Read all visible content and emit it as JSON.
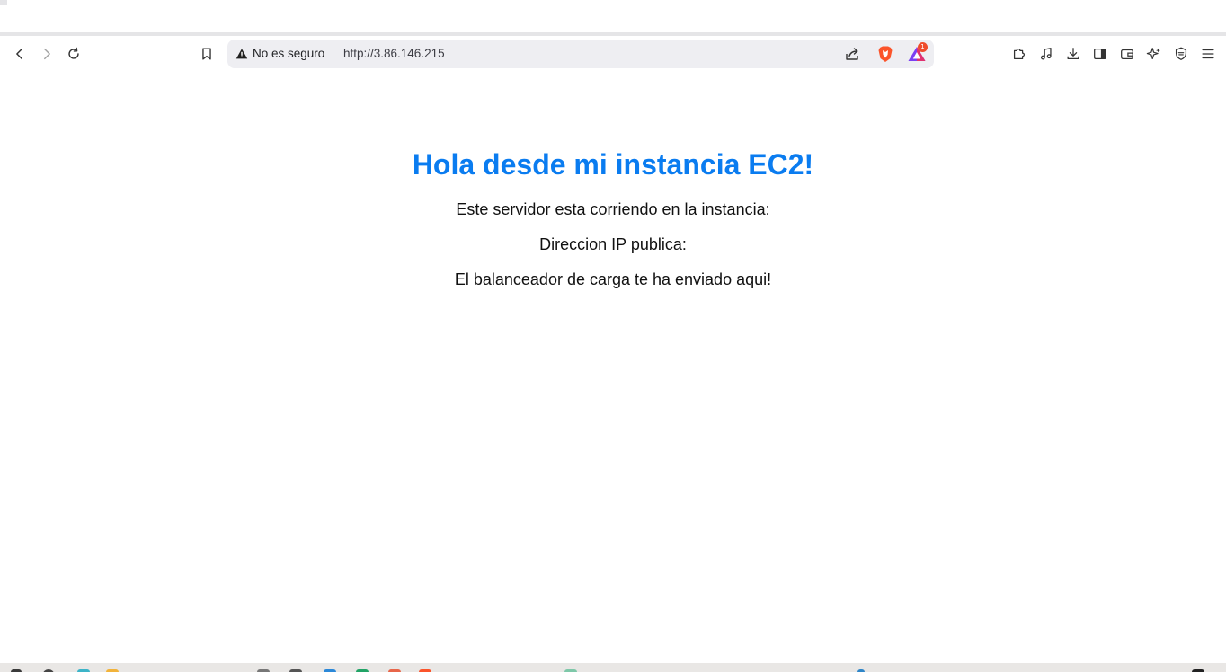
{
  "browser": {
    "toolbar": {
      "back_icon": "arrow-left-icon",
      "forward_icon": "arrow-right-icon",
      "reload_icon": "reload-icon",
      "bookmark_icon": "bookmark-icon"
    },
    "address_bar": {
      "security_label": "No es seguro",
      "url": "http://3.86.146.215",
      "rewards_badge": "1"
    },
    "extensions_icons": [
      "puzzle-icon",
      "music-icon",
      "download-icon",
      "sidebar-icon",
      "wallet-icon",
      "leo-ai-icon",
      "vpn-shield-icon",
      "menu-icon"
    ]
  },
  "page": {
    "heading": "Hola desde mi instancia EC2!",
    "line1": "Este servidor esta corriendo en la instancia:",
    "line2": "Direccion IP publica:",
    "line3": "El balanceador de carga te ha enviado aqui!"
  },
  "colors": {
    "heading": "#0a7cf0",
    "text": "#111111",
    "urlbar_bg": "#eeeef2",
    "brave_orange": "#fb542b"
  }
}
